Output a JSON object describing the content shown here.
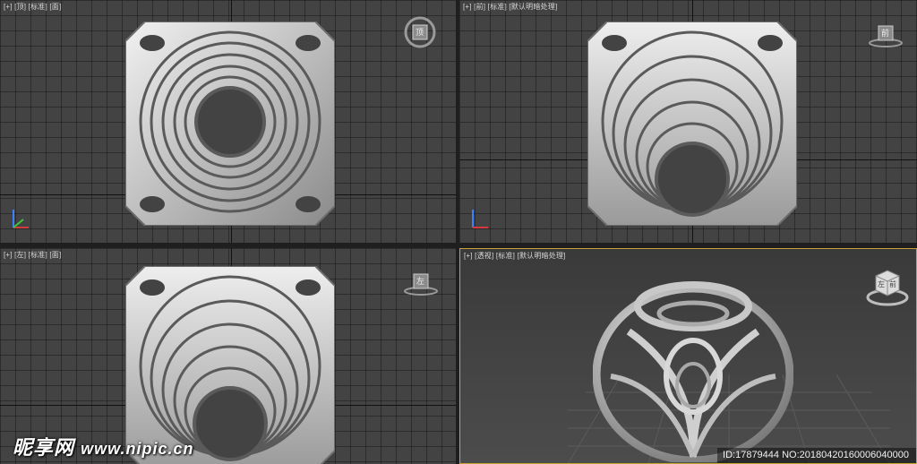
{
  "viewports": {
    "top": {
      "views": [
        "[+]",
        "[顶]",
        "[标准]",
        "[面]"
      ],
      "cube_face": "顶"
    },
    "front": {
      "views": [
        "[+]",
        "[前]",
        "[标准]",
        "[默认明暗处理]"
      ],
      "cube_face": "前"
    },
    "left": {
      "views": [
        "[+]",
        "[左]",
        "[标准]",
        "[面]"
      ],
      "cube_face": "左"
    },
    "perspective": {
      "views": [
        "[+]",
        "[透视]",
        "[标准]",
        "[默认明暗处理]"
      ],
      "cube_faces": [
        "左",
        "前"
      ]
    }
  },
  "watermark": {
    "brand": "昵享网",
    "url": "www.nipic.cn"
  },
  "image_id": "ID:17879444 NO:20180420160006040000",
  "colors": {
    "viewport_bg": "#434343",
    "active_border": "#c9a23a",
    "model": "#c9c9c9"
  }
}
